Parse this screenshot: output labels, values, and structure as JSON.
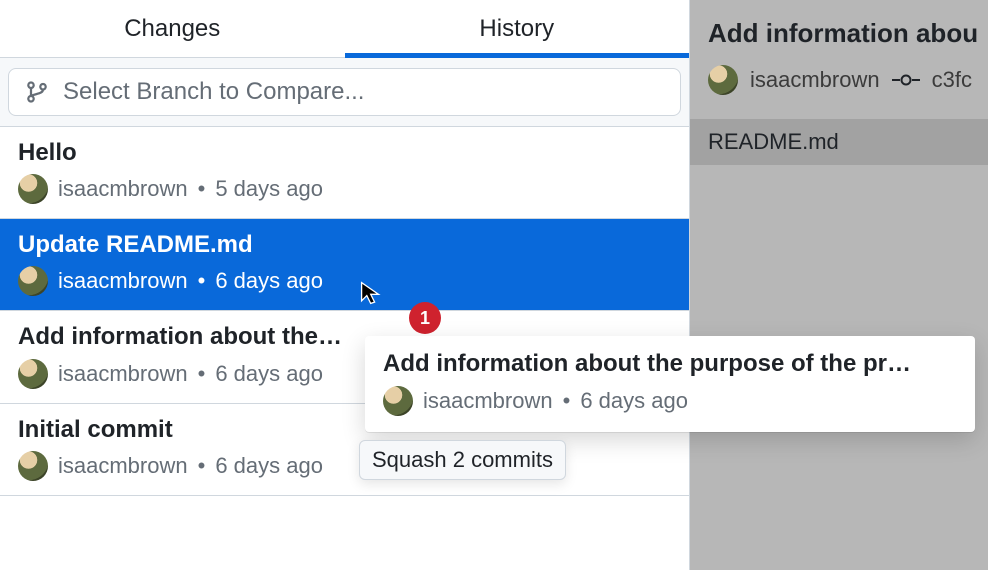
{
  "tabs": {
    "changes": "Changes",
    "history": "History"
  },
  "branchSelect": {
    "placeholder": "Select Branch to Compare..."
  },
  "commits": [
    {
      "title": "Hello",
      "author": "isaacmbrown",
      "time": "5 days ago"
    },
    {
      "title": "Update README.md",
      "author": "isaacmbrown",
      "time": "6 days ago"
    },
    {
      "title": "Add information about the pu",
      "author": "isaacmbrown",
      "time": "6 days ago"
    },
    {
      "title": "Initial commit",
      "author": "isaacmbrown",
      "time": "6 days ago"
    }
  ],
  "drag": {
    "badge": "1",
    "title": "Add information about the purpose of the pr…",
    "author": "isaacmbrown",
    "time": "6 days ago",
    "tooltip": "Squash 2 commits"
  },
  "detail": {
    "title": "Add information abou",
    "author": "isaacmbrown",
    "sha": "c3fc",
    "file": "README.md"
  },
  "separator": "•"
}
